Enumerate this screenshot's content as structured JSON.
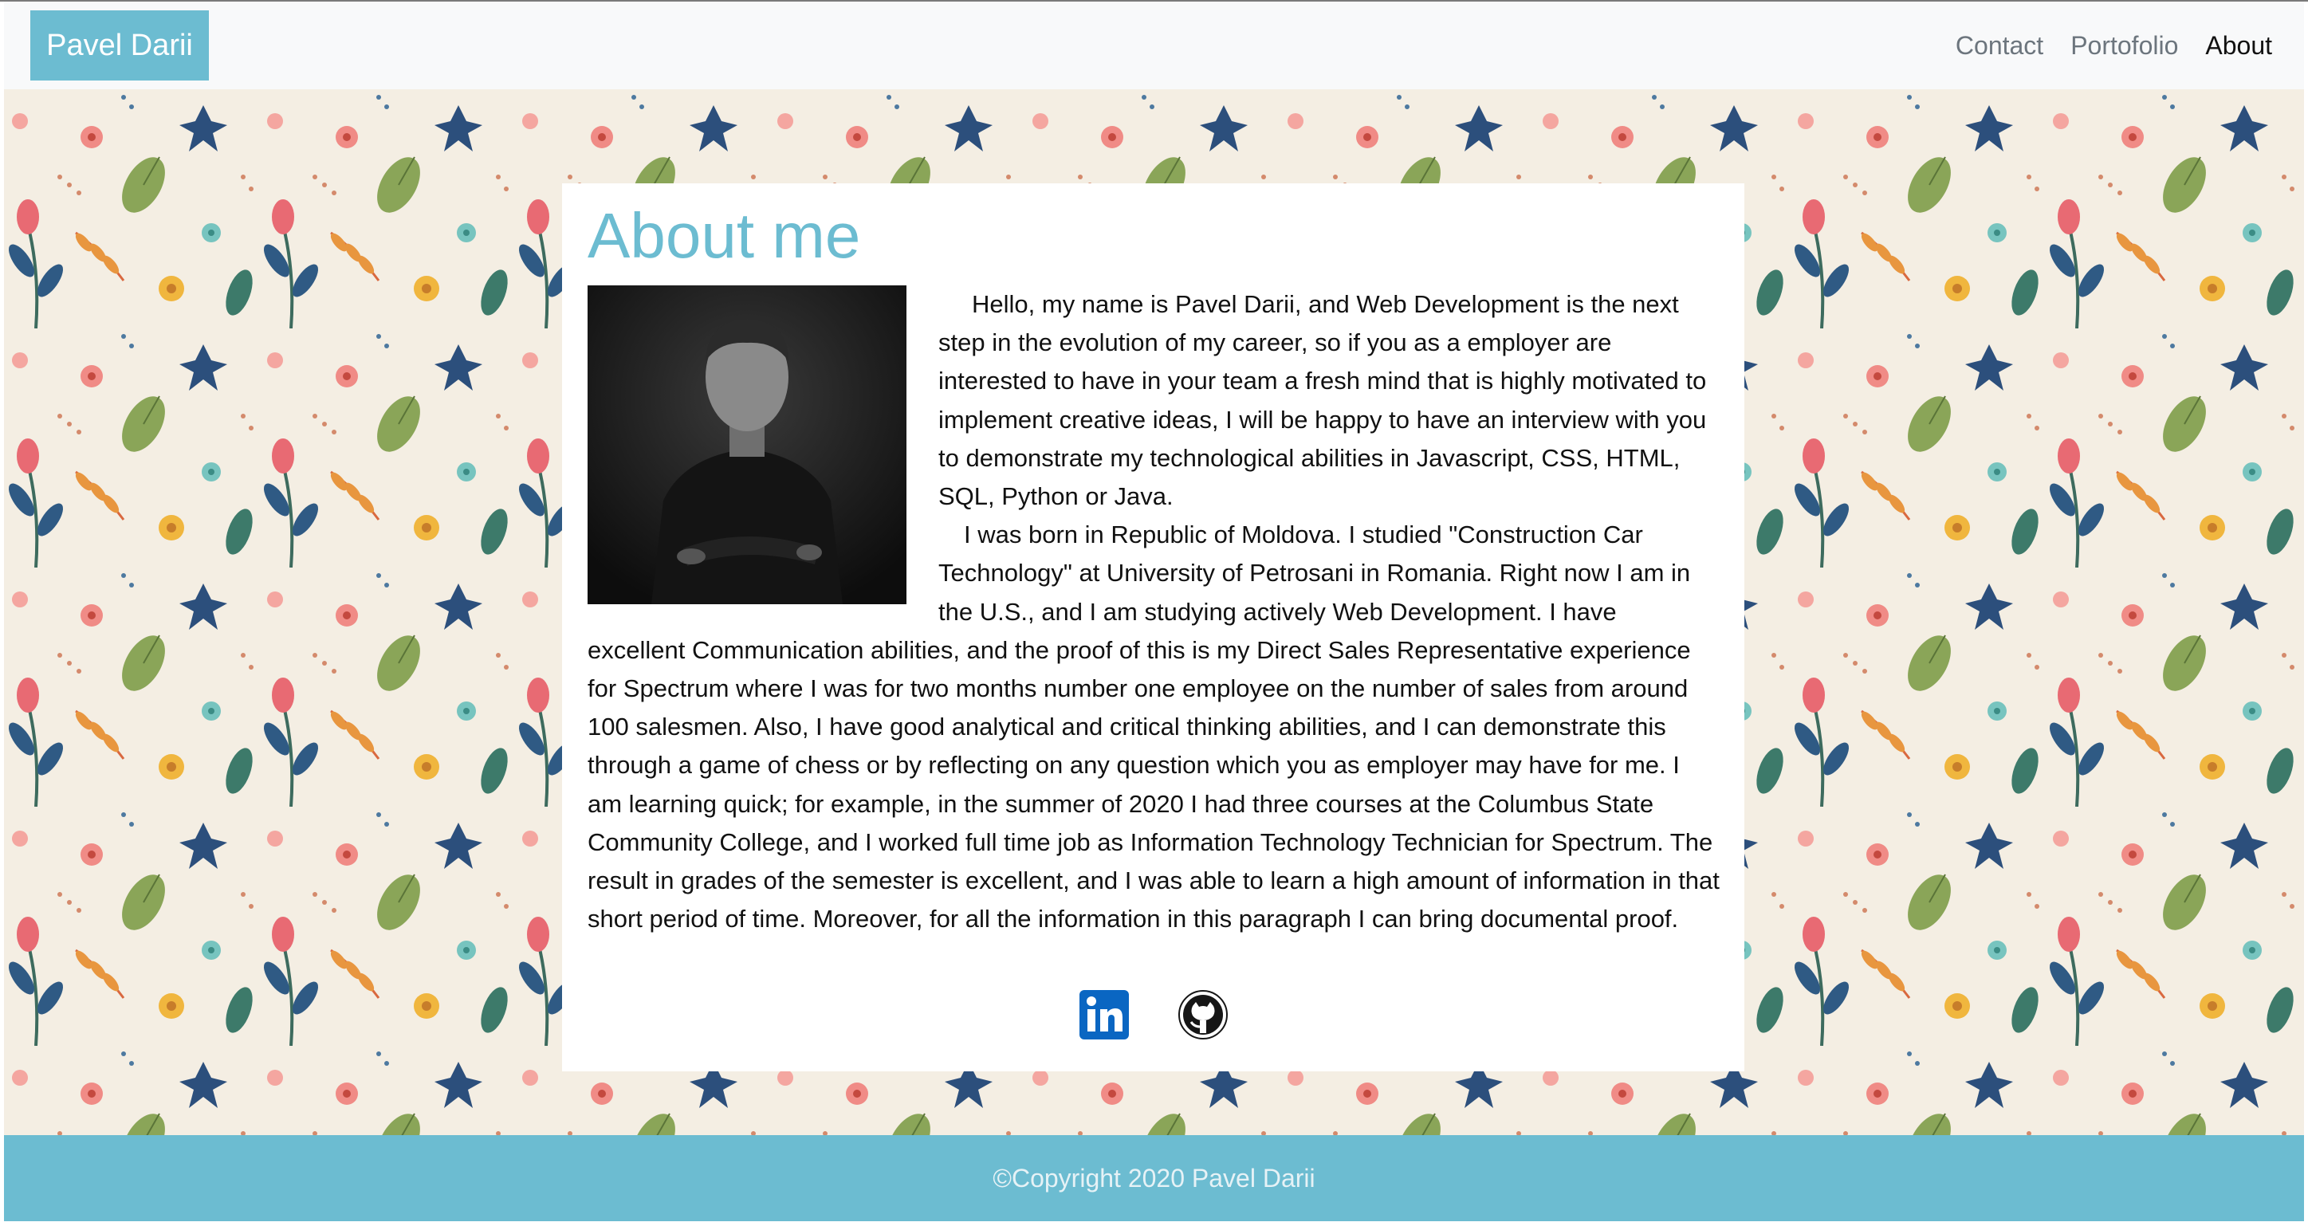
{
  "navbar": {
    "brand": "Pavel Darii",
    "links": [
      {
        "label": "Contact",
        "active": false
      },
      {
        "label": "Portofolio",
        "active": false
      },
      {
        "label": "About",
        "active": true
      }
    ]
  },
  "about": {
    "title": "About me",
    "paragraphs": [
      "Hello, my name is Pavel Darii, and Web Development is the next step in the evolution of my career, so if you as a employer are interested to have in your team a fresh mind that is highly motivated to implement creative ideas, I will be happy to have an interview with you to demonstrate my technological abilities in Javascript, CSS, HTML, SQL, Python or Java.",
      "I was born in Republic of Moldova. I studied \"Construction Car Technology\" at University of Petrosani in Romania. Right now I am in the U.S., and I am studying actively Web Development. I have excellent Communication abilities, and the proof of this is my Direct Sales Representative experience for Spectrum where I was for two months number one employee on the number of sales from around 100 salesmen. Also, I have good analytical and critical thinking abilities, and I can demonstrate this through a game of chess or by reflecting on any question which you as employer may have for me. I am learning quick; for example, in the summer of 2020 I had three courses at the Columbus State Community College, and I worked full time job as Information Technology Technician for Spectrum. The result in grades of the semester is excellent, and I was able to learn a high amount of information in that short period of time. Moreover, for all the information in this paragraph I can bring documental proof."
    ],
    "social": [
      {
        "icon": "linkedin-icon"
      },
      {
        "icon": "github-icon"
      }
    ]
  },
  "footer": {
    "text": "©Copyright 2020 Pavel Darii"
  },
  "colors": {
    "accent": "#6cbcd1",
    "background_pattern": "#f4eee3"
  }
}
